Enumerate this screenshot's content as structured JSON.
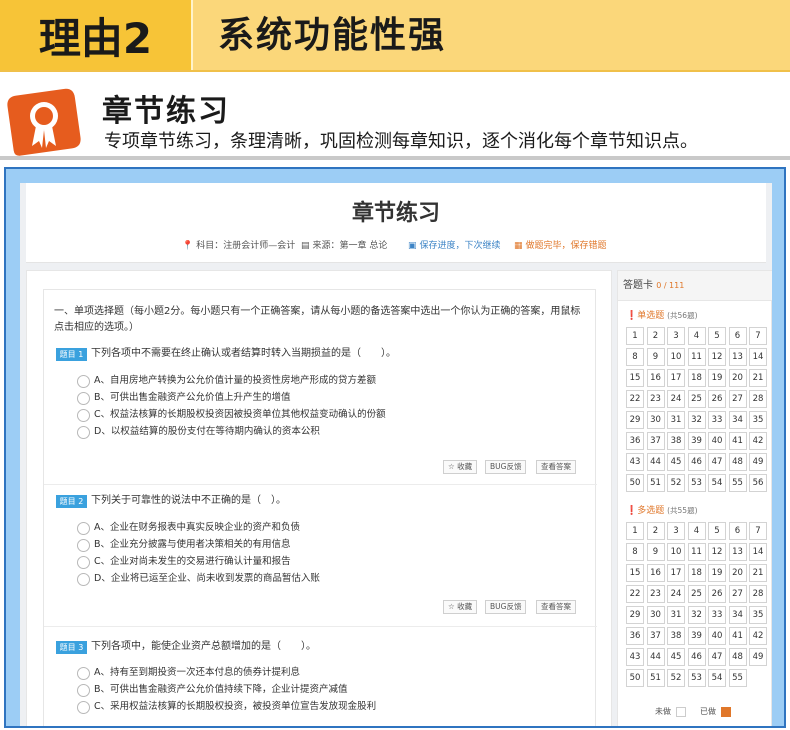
{
  "banner": {
    "tag": "理由2",
    "title": "系统功能性强"
  },
  "section": {
    "title": "章节练习",
    "desc": "专项章节练习，条理清晰，巩固检测每章知识，逐个消化每个章节知识点。"
  },
  "app": {
    "title": "章节练习",
    "subject": "科目：注册会计师—会计",
    "source": "来源：第一章 总论",
    "save_progress": "保存进度，下次继续",
    "finish": "做题完毕，保存错题"
  },
  "intro": "一、单项选择题（每小题2分。每小题只有一个正确答案，请从每小题的备选答案中选出一个你认为正确的答案，用鼠标点击相应的选项。）",
  "buttons": {
    "favorite": "☆ 收藏",
    "bug": "BUG反馈",
    "answer": "查看答案"
  },
  "questions": [
    {
      "tag": "题目 1",
      "text": "下列各项中不需要在终止确认或者结算时转入当期损益的是（　　）。",
      "options": [
        "A、自用房地产转换为公允价值计量的投资性房地产形成的贷方差额",
        "B、可供出售金融资产公允价值上升产生的增值",
        "C、权益法核算的长期股权投资因被投资单位其他权益变动确认的份额",
        "D、以权益结算的股份支付在等待期内确认的资本公积"
      ]
    },
    {
      "tag": "题目 2",
      "text": "下列关于可靠性的说法中不正确的是（　）。",
      "options": [
        "A、企业在财务报表中真实反映企业的资产和负债",
        "B、企业充分披露与使用者决策相关的有用信息",
        "C、企业对尚未发生的交易进行确认计量和报告",
        "D、企业将已运至企业、尚未收到发票的商品暂估入账"
      ]
    },
    {
      "tag": "题目 3",
      "text": "下列各项中，能使企业资产总额增加的是（　　）。",
      "options": [
        "A、持有至到期投资一次还本付息的债券计提利息",
        "B、可供出售金融资产公允价值持续下降，企业计提资产减值",
        "C、采用权益法核算的长期股权投资，被投资单位宣告发放现金股利"
      ]
    }
  ],
  "card": {
    "title": "答题卡",
    "count": "0 / 111",
    "single": {
      "label": "单选题",
      "note": "(共56题)"
    },
    "multi": {
      "label": "多选题",
      "note": "(共55题)"
    },
    "legend_undone": "未做",
    "legend_done": "已做"
  },
  "colors": {
    "tag": "#3aa1de",
    "accent": "#e0772a",
    "banner": "#f7c437",
    "frame": "#9ccdf5"
  }
}
